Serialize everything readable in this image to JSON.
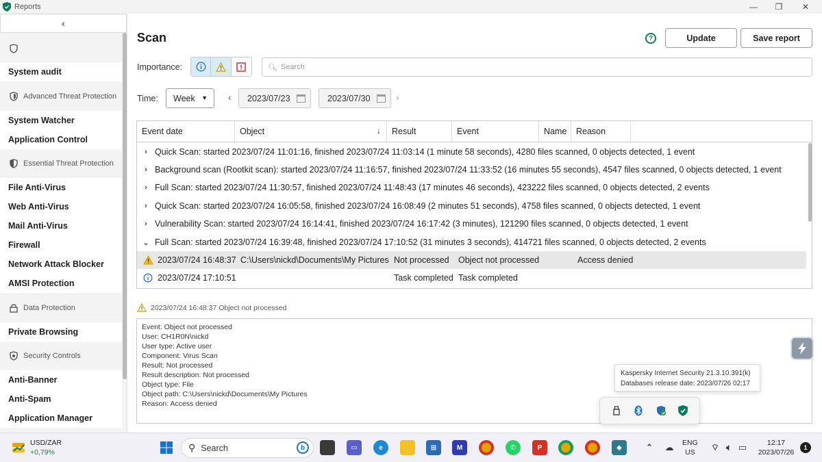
{
  "window": {
    "title": "Reports"
  },
  "sidebar": {
    "top_items": [
      {
        "label": "System audit"
      }
    ],
    "groups": [
      {
        "label": "Advanced Threat Protection",
        "items": [
          "System Watcher",
          "Application Control"
        ]
      },
      {
        "label": "Essential Threat Protection",
        "items": [
          "File Anti-Virus",
          "Web Anti-Virus",
          "Mail Anti-Virus",
          "Firewall",
          "Network Attack Blocker",
          "AMSI Protection"
        ]
      },
      {
        "label": "Data Protection",
        "items": [
          "Private Browsing"
        ]
      },
      {
        "label": "Security Controls",
        "items": [
          "Anti-Banner",
          "Anti-Spam",
          "Application Manager"
        ]
      }
    ]
  },
  "main": {
    "title": "Scan",
    "update_label": "Update",
    "save_report_label": "Save report",
    "importance_label": "Importance:",
    "search_placeholder": "Search",
    "time_label": "Time:",
    "period": "Week",
    "date_from": "2023/07/23",
    "date_to": "2023/07/30"
  },
  "table": {
    "columns": [
      "Event date",
      "Object",
      "Result",
      "Event",
      "Name",
      "Reason"
    ],
    "groups": [
      "Quick Scan: started 2023/07/24 11:01:16, finished 2023/07/24 11:03:14 (1 minute 58 seconds), 4280 files scanned, 0 objects detected, 1 event",
      "Background scan (Rootkit scan): started 2023/07/24 11:16:57, finished 2023/07/24 11:33:52 (16 minutes 55 seconds), 4547 files scanned, 0 objects detected, 1 event",
      "Full Scan: started 2023/07/24 11:30:57, finished 2023/07/24 11:48:43 (17 minutes 46 seconds), 423222 files scanned, 0 objects detected, 2 events",
      "Quick Scan: started 2023/07/24 16:05:58, finished 2023/07/24 16:08:49 (2 minutes 51 seconds), 4758 files scanned, 0 objects detected, 1 event",
      "Vulnerability Scan: started 2023/07/24 16:14:41, finished 2023/07/24 16:17:42 (3 minutes), 121290 files scanned, 0 objects detected, 1 event",
      "Full Scan: started 2023/07/24 16:39:48, finished 2023/07/24 17:10:52 (31 minutes 3 seconds), 414721 files scanned, 0 objects detected, 2 events"
    ],
    "events": [
      {
        "date": "2023/07/24 16:48:37",
        "object": "C:\\Users\\nickd\\Documents\\My Pictures",
        "result": "Not processed",
        "event": "Object not processed",
        "name": "",
        "reason": "Access denied"
      },
      {
        "date": "2023/07/24 17:10:51",
        "object": "",
        "result": "Task completed",
        "event": "Task completed",
        "name": "",
        "reason": ""
      }
    ]
  },
  "detail": {
    "header": "2023/07/24 16:48:37 Object not processed",
    "lines": [
      "Event: Object not processed",
      "User: CH1R0N\\nickd",
      "User type: Active user",
      "Component: Virus Scan",
      "Result: Not processed",
      "Result description: Not processed",
      "Object type: File",
      "Object path: C:\\Users\\nickd\\Documents\\My Pictures",
      "Reason: Access denied"
    ]
  },
  "tooltip": {
    "line1": "Kaspersky Internet Security 21.3.10.391(k)",
    "line2": "Databases release date: 2023/07/26 02:17"
  },
  "taskbar": {
    "widget_title": "USD/ZAR",
    "widget_value": "+0,79%",
    "search_label": "Search",
    "lang": "ENG",
    "region": "US",
    "time": "12:17",
    "date": "2023/07/26",
    "notification_count": "1"
  },
  "colors": {
    "brand_green": "#0b7a5c",
    "selected_row": "#e6e6e6",
    "warning": "#e8a600",
    "info": "#1a73c9",
    "error": "#c62828"
  }
}
